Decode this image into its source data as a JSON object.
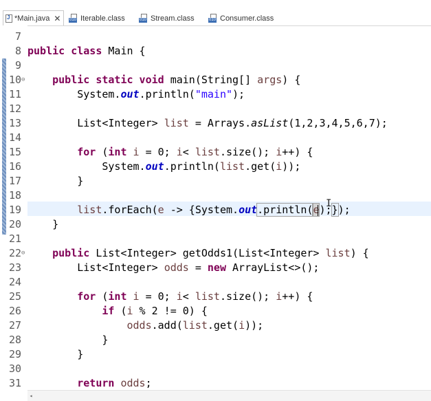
{
  "tabs": [
    {
      "label": "*Main.java",
      "active": true,
      "icon": "java-file-icon",
      "closable": true
    },
    {
      "label": "Iterable.class",
      "active": false,
      "icon": "class-file-icon"
    },
    {
      "label": "Stream.class",
      "active": false,
      "icon": "class-file-icon"
    },
    {
      "label": "Consumer.class",
      "active": false,
      "icon": "class-file-icon"
    }
  ],
  "editor": {
    "line_numbers": [
      "7",
      "8",
      "9",
      "10",
      "11",
      "12",
      "13",
      "14",
      "15",
      "16",
      "17",
      "18",
      "19",
      "20",
      "21",
      "22",
      "23",
      "24",
      "25",
      "26",
      "27",
      "28",
      "29",
      "30",
      "31"
    ],
    "fold_markers": [
      "⊖",
      "⊖"
    ],
    "current_line": "19",
    "lines": {
      "l8": {
        "kw1": "public class",
        "rest": " Main {"
      },
      "l10": {
        "kw1": "public static void",
        "rest1": " main(String[] ",
        "var": "args",
        "rest2": ") {"
      },
      "l11": {
        "pre": "System.",
        "field": "out",
        "mid": ".println(",
        "str": "\"main\"",
        "end": ");"
      },
      "l13": {
        "pre": "List<Integer> ",
        "var": "list",
        "mid": " = Arrays.",
        "method": "asList",
        "end": "(1,2,3,4,5,6,7);"
      },
      "l15": {
        "kw1": "for",
        "mid1": " (",
        "kw2": "int",
        "sp": " ",
        "var1": "i",
        "mid2": " = 0; ",
        "var2": "i",
        "mid3": "< ",
        "var3": "list",
        "mid4": ".size(); ",
        "var4": "i",
        "end": "++) {"
      },
      "l16": {
        "pre": "System.",
        "field": "out",
        "mid": ".println(",
        "var1": "list",
        "mid2": ".get(",
        "var2": "i",
        "end": "));"
      },
      "l17": {
        "text": "}"
      },
      "l19": {
        "var1": "list",
        "mid1": ".forEach(",
        "var2": "e",
        "mid2": " -> {System.",
        "field": "out",
        "mid3": ".println(",
        "hl": "e",
        "mid4": ");",
        "brace": "}",
        "end": ");"
      },
      "l20": {
        "text": "}"
      },
      "l22": {
        "kw1": "public",
        "rest1": " List<Integer> getOdds1(List<Integer> ",
        "var": "list",
        "rest2": ") {"
      },
      "l23": {
        "pre": "List<Integer> ",
        "var": "odds",
        "mid": " = ",
        "kw": "new",
        "end": " ArrayList<>();"
      },
      "l25": {
        "kw1": "for",
        "mid1": " (",
        "kw2": "int",
        "sp": " ",
        "var1": "i",
        "mid2": " = 0; ",
        "var2": "i",
        "mid3": "< ",
        "var3": "list",
        "mid4": ".size(); ",
        "var4": "i",
        "end": "++) {"
      },
      "l26": {
        "kw": "if",
        "mid": " (",
        "var": "i",
        "end": " % 2 != 0) {"
      },
      "l27": {
        "var1": "odds",
        "mid": ".add(",
        "var2": "list",
        "mid2": ".get(",
        "var3": "i",
        "end": "));"
      },
      "l28": {
        "text": "}"
      },
      "l29": {
        "text": "}"
      },
      "l31": {
        "kw": "return",
        "sp": " ",
        "var": "odds",
        "end": ";"
      }
    }
  },
  "colors": {
    "keyword": "#7f0055",
    "string": "#2a00ff",
    "local_var": "#6a3e3e",
    "static_field": "#0000c0",
    "current_line": "#e8f2fe"
  },
  "scrollbar": {
    "left_arrow": "◂"
  }
}
